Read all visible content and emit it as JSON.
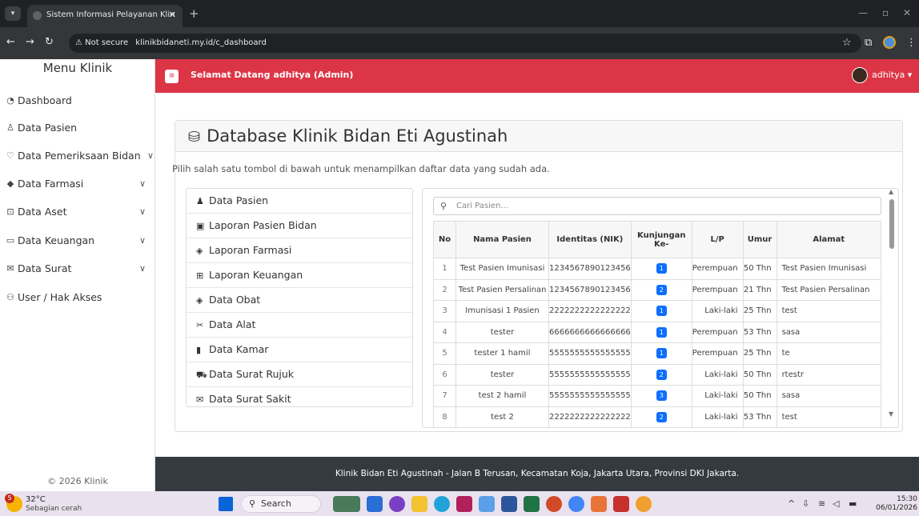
{
  "browser": {
    "tab_title": "Sistem Informasi Pelayanan Klin",
    "tab_close": "✕",
    "new_tab": "+",
    "security": "Not secure",
    "url": "klinikbidaneti.my.id/c_dashboard"
  },
  "sidebar": {
    "title": "Menu Klinik",
    "items": [
      {
        "label": "Dashboard",
        "icon": "dashboard-icon"
      },
      {
        "label": "Data Pasien",
        "icon": "user-icon"
      },
      {
        "label": "Data Pemeriksaan Bidan",
        "icon": "stethoscope-icon",
        "expandable": true
      },
      {
        "label": "Data Farmasi",
        "icon": "pill-icon",
        "expandable": true
      },
      {
        "label": "Data Aset",
        "icon": "box-icon",
        "expandable": true
      },
      {
        "label": "Data Keuangan",
        "icon": "wallet-icon",
        "expandable": true
      },
      {
        "label": "Data Surat",
        "icon": "mail-icon",
        "expandable": true
      },
      {
        "label": "User / Hak Akses",
        "icon": "users-icon"
      }
    ],
    "footer": "© 2026 Klinik"
  },
  "topbar": {
    "welcome": "Selamat Datang adhitya (Admin)",
    "username": "adhitya ▾"
  },
  "card": {
    "title": "Database Klinik Bidan Eti Agustinah",
    "description": "Pilih salah satu tombol di bawah untuk menampilkan daftar data yang sudah ada.",
    "buttons": [
      {
        "label": "Data Pasien",
        "icon": "user-icon"
      },
      {
        "label": "Laporan Pasien Bidan",
        "icon": "report-icon"
      },
      {
        "label": "Laporan Farmasi",
        "icon": "pill-icon"
      },
      {
        "label": "Laporan Keuangan",
        "icon": "money-icon"
      },
      {
        "label": "Data Obat",
        "icon": "pill-icon"
      },
      {
        "label": "Data Alat",
        "icon": "tools-icon"
      },
      {
        "label": "Data Kamar",
        "icon": "door-icon"
      },
      {
        "label": "Data Surat Rujuk",
        "icon": "ambulance-icon"
      },
      {
        "label": "Data Surat Sakit",
        "icon": "envelope-icon"
      }
    ]
  },
  "table": {
    "search_placeholder": "Cari Pasien...",
    "headers": [
      "No",
      "Nama Pasien",
      "Identitas (NIK)",
      "Kunjungan Ke-",
      "L/P",
      "Umur",
      "Alamat"
    ],
    "rows": [
      [
        "1",
        "Test Pasien Imunisasi",
        "1234567890123456",
        "1",
        "Perempuan",
        "50 Thn",
        "Test Pasien Imunisasi"
      ],
      [
        "2",
        "Test Pasien Persalinan",
        "1234567890123456",
        "2",
        "Perempuan",
        "21 Thn",
        "Test Pasien Persalinan"
      ],
      [
        "3",
        "Imunisasi 1 Pasien",
        "2222222222222222",
        "1",
        "Laki-laki",
        "25 Thn",
        "test"
      ],
      [
        "4",
        "tester",
        "6666666666666666",
        "1",
        "Perempuan",
        "53 Thn",
        "sasa"
      ],
      [
        "5",
        "tester 1 hamil",
        "5555555555555555",
        "1",
        "Perempuan",
        "25 Thn",
        "te"
      ],
      [
        "6",
        "tester",
        "5555555555555555",
        "2",
        "Laki-laki",
        "50 Thn",
        "rtestr"
      ],
      [
        "7",
        "test 2 hamil",
        "5555555555555555",
        "3",
        "Laki-laki",
        "50 Thn",
        "sasa"
      ],
      [
        "8",
        "test 2",
        "2222222222222222",
        "2",
        "Laki-laki",
        "53 Thn",
        "test"
      ]
    ]
  },
  "footer": "Klinik Bidan Eti Agustinah - Jalan B Terusan, Kecamatan Koja, Jakarta Utara, Provinsi DKI Jakarta.",
  "taskbar": {
    "weather_badge": "5",
    "temperature": "32°C",
    "weather_desc": "Sebagian cerah",
    "search": "Search",
    "time": "15:30",
    "date": "06/01/2026"
  },
  "colors": {
    "topbar": "#dc3545",
    "footer": "#343a40",
    "badge": "#0d6efd"
  }
}
